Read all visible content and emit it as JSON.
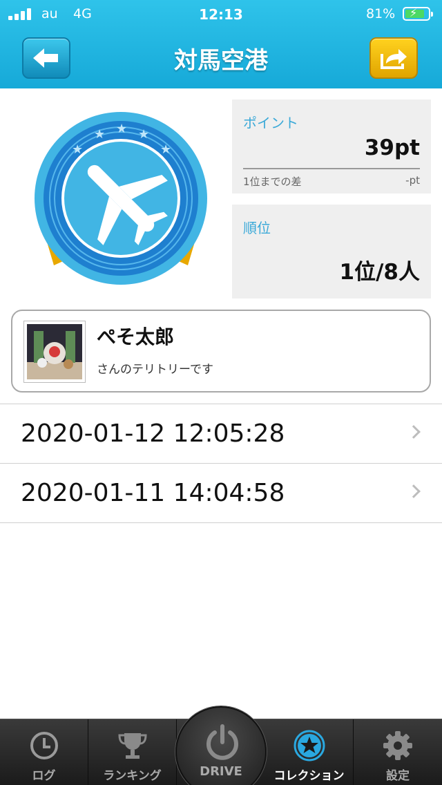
{
  "status_bar": {
    "carrier": "au",
    "network": "4G",
    "time": "12:13",
    "battery_percent": "81%"
  },
  "nav": {
    "title": "対馬空港",
    "back_icon": "back-arrow-icon",
    "share_icon": "share-icon"
  },
  "badge": {
    "icon": "airplane-icon"
  },
  "points_card": {
    "label": "ポイント",
    "value": "39pt",
    "diff_label": "1位までの差",
    "diff_value": "-pt"
  },
  "rank_card": {
    "label": "順位",
    "value": "1位/8人"
  },
  "owner": {
    "name": "ぺそ太郎",
    "subtitle": "さんのテリトリーです"
  },
  "history": [
    {
      "time": "2020-01-12 12:05:28"
    },
    {
      "time": "2020-01-11 14:04:58"
    }
  ],
  "tabs": [
    {
      "label": "ログ",
      "icon": "clock-icon"
    },
    {
      "label": "ランキング",
      "icon": "trophy-icon"
    },
    {
      "label": "DRIVE",
      "icon": "power-icon"
    },
    {
      "label": "コレクション",
      "icon": "star-icon",
      "active": true
    },
    {
      "label": "設定",
      "icon": "gear-icon"
    }
  ],
  "colors": {
    "header": "#16a9d8",
    "accent_label": "#3aa9d8",
    "share_button": "#f0b400",
    "card_bg": "#efefef",
    "tab_active": "#2aa8e0"
  }
}
